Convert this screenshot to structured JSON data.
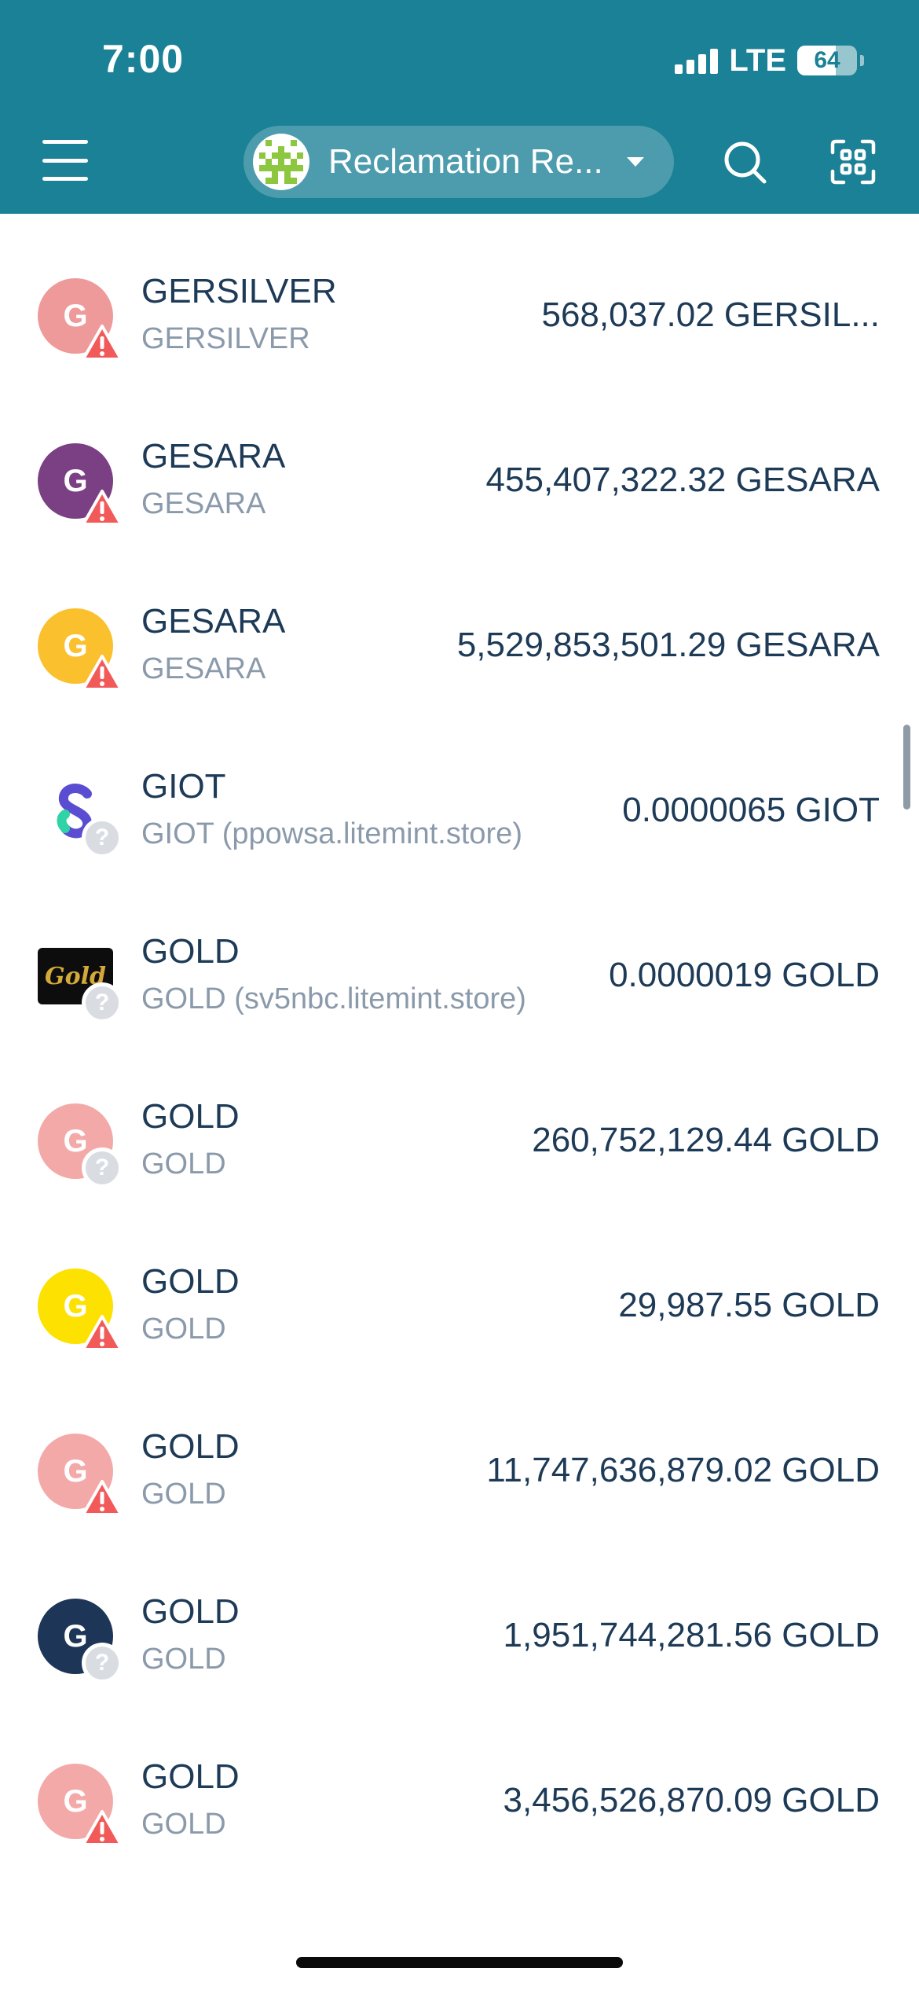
{
  "status_bar": {
    "time": "7:00",
    "network": "LTE",
    "battery": "64",
    "battery_level": 0.64
  },
  "header": {
    "account_name": "Reclamation Re...",
    "icons": {
      "menu": "hamburger-menu-icon",
      "search": "search-icon",
      "scan": "qr-scan-icon",
      "account_avatar": "identicon-avatar"
    },
    "colors": {
      "header_bg": "#1b8196",
      "account_avatar": "#8dc63f"
    }
  },
  "assets": [
    {
      "code": "GERSILVER",
      "issuer": "GERSILVER",
      "amount": "568,037.02 GERSIL...",
      "icon_letter": "G",
      "icon_color": "#ef9a9a",
      "icon_type": "letter",
      "badge": "warning"
    },
    {
      "code": "GESARA",
      "issuer": "GESARA",
      "amount": "455,407,322.32 GESARA",
      "icon_letter": "G",
      "icon_color": "#7b3f84",
      "icon_type": "letter",
      "badge": "warning"
    },
    {
      "code": "GESARA",
      "issuer": "GESARA",
      "amount": "5,529,853,501.29 GESARA",
      "icon_letter": "G",
      "icon_color": "#fbc02d",
      "icon_type": "letter",
      "badge": "warning"
    },
    {
      "code": "GIOT",
      "issuer": "GIOT (ppowsa.litemint.store)",
      "amount": "0.0000065 GIOT",
      "icon_letter": "",
      "icon_color": "#5b4dd1",
      "icon_type": "giot",
      "badge": "unknown"
    },
    {
      "code": "GOLD",
      "issuer": "GOLD (sv5nbc.litemint.store)",
      "amount": "0.0000019 GOLD",
      "icon_letter": "Gold",
      "icon_color": "#0d0d0d",
      "icon_type": "gold",
      "badge": "unknown"
    },
    {
      "code": "GOLD",
      "issuer": "GOLD",
      "amount": "260,752,129.44 GOLD",
      "icon_letter": "G",
      "icon_color": "#f4a9a9",
      "icon_type": "letter",
      "badge": "unknown"
    },
    {
      "code": "GOLD",
      "issuer": "GOLD",
      "amount": "29,987.55 GOLD",
      "icon_letter": "G",
      "icon_color": "#fde100",
      "icon_type": "letter",
      "badge": "warning"
    },
    {
      "code": "GOLD",
      "issuer": "GOLD",
      "amount": "11,747,636,879.02 GOLD",
      "icon_letter": "G",
      "icon_color": "#f4a9a9",
      "icon_type": "letter",
      "badge": "warning"
    },
    {
      "code": "GOLD",
      "issuer": "GOLD",
      "amount": "1,951,744,281.56 GOLD",
      "icon_letter": "G",
      "icon_color": "#1d3557",
      "icon_type": "letter",
      "badge": "unknown"
    },
    {
      "code": "GOLD",
      "issuer": "GOLD",
      "amount": "3,456,526,870.09 GOLD",
      "icon_letter": "G",
      "icon_color": "#f4a9a9",
      "icon_type": "letter",
      "badge": "warning"
    }
  ],
  "badges": {
    "warning_icon": "warning-triangle-icon",
    "warning_color": "#f25a5a",
    "unknown_icon": "question-mark-icon",
    "unknown_symbol": "?",
    "unknown_color": "#d9dde2"
  }
}
